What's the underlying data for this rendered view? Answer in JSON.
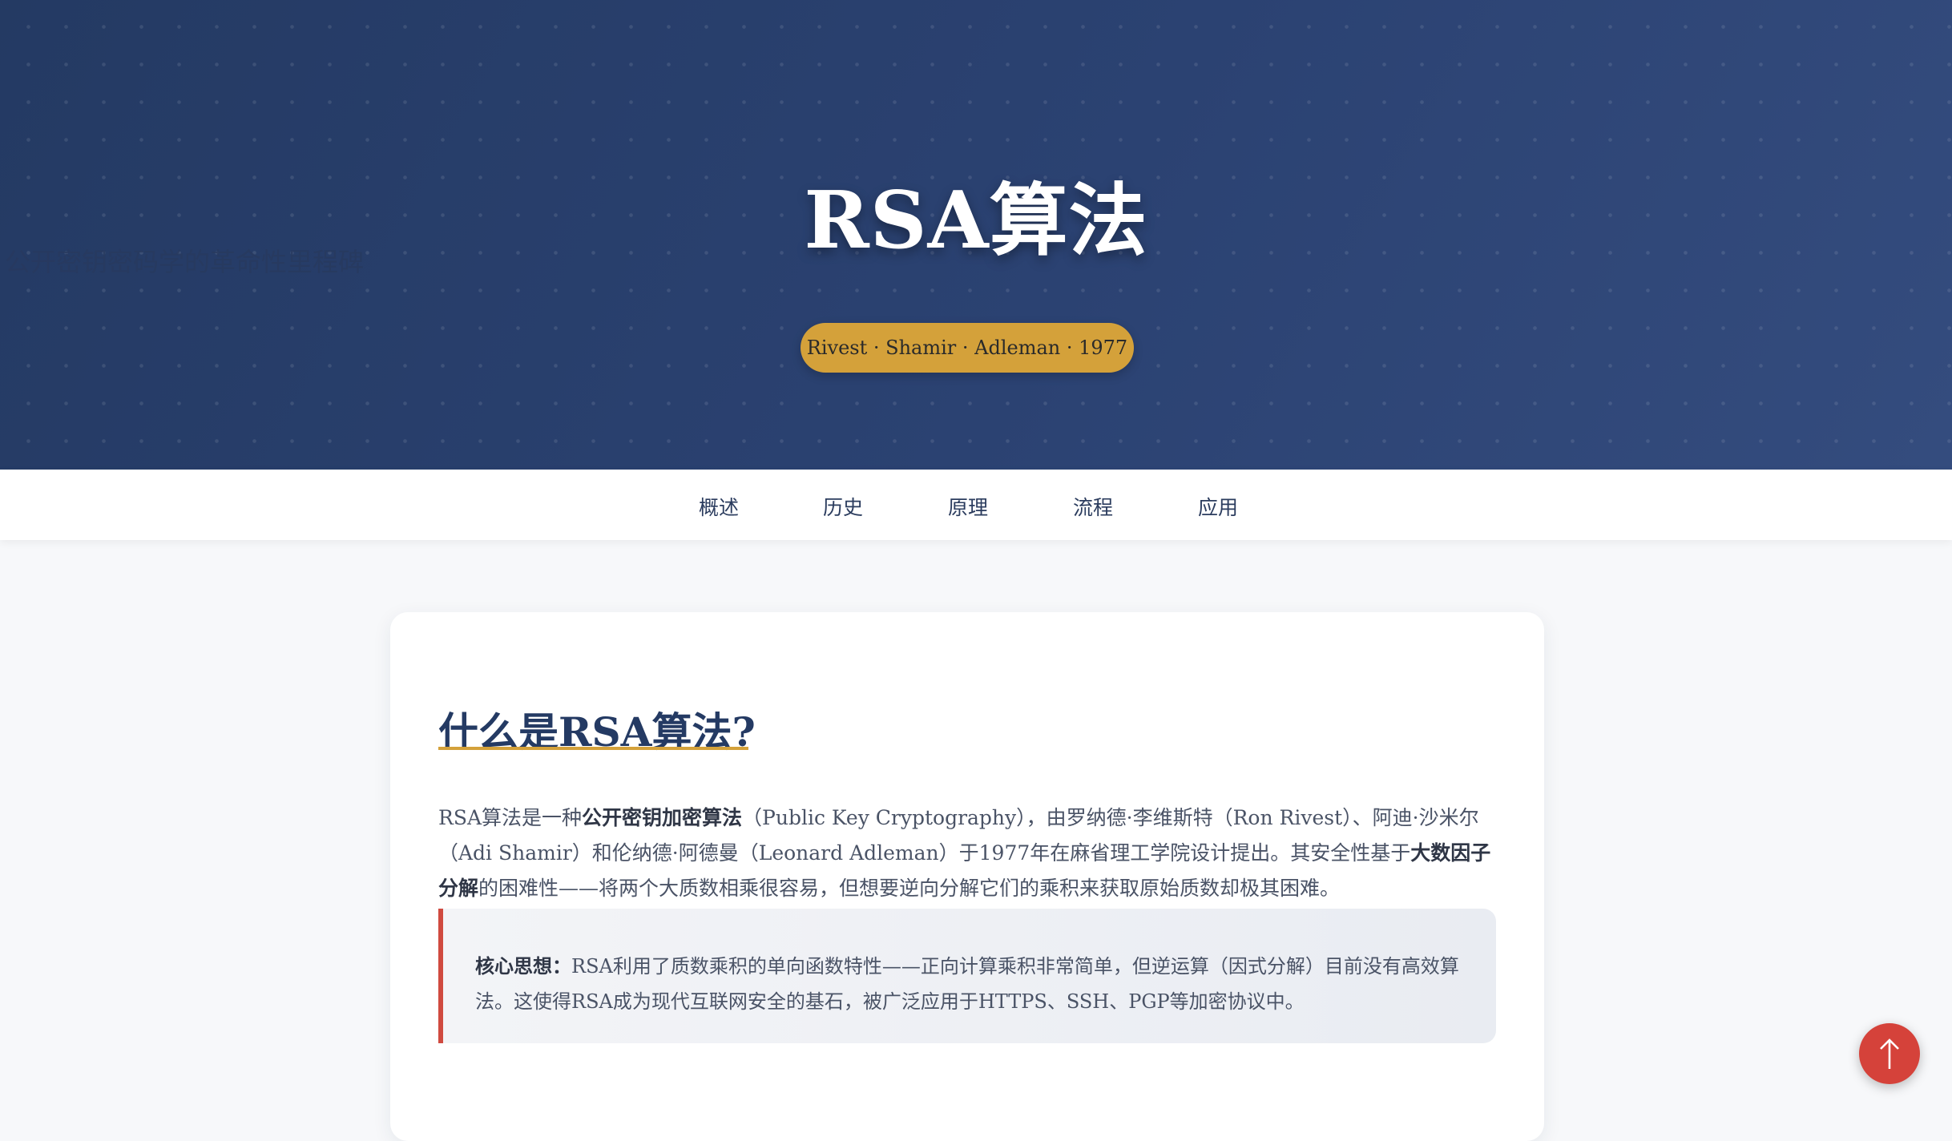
{
  "hero": {
    "title": "RSA算法",
    "subtitle": "公开密钥密码学的革命性里程碑",
    "badge": "Rivest · Shamir · Adleman · 1977"
  },
  "nav": {
    "items": [
      {
        "label": "概述"
      },
      {
        "label": "历史"
      },
      {
        "label": "原理"
      },
      {
        "label": "流程"
      },
      {
        "label": "应用"
      }
    ]
  },
  "overview": {
    "title": "什么是RSA算法?",
    "para": {
      "t1": "RSA算法是一种",
      "b1": "公开密钥加密算法",
      "t2": "（Public Key Cryptography），由罗纳德·李维斯特（Ron Rivest）、阿迪·沙米尔（Adi Shamir）和伦纳德·阿德曼（Leonard Adleman）于1977年在麻省理工学院设计提出。其安全性基于",
      "b2": "大数因子分解",
      "t3": "的困难性——将两个大质数相乘很容易，但想要逆向分解它们的乘积来获取原始质数却极其困难。"
    },
    "callout": {
      "label": "核心思想：",
      "text": "RSA利用了质数乘积的单向函数特性——正向计算乘积非常简单，但逆运算（因式分解）目前没有高效算法。这使得RSA成为现代互联网安全的基石，被广泛应用于HTTPS、SSH、PGP等加密协议中。"
    }
  },
  "back_to_top": {
    "icon": "arrow-up-icon"
  },
  "colors": {
    "hero_bg": "#2b4272",
    "accent_gold": "#d4a13a",
    "accent_red": "#d5423a",
    "title_navy": "#243a63"
  }
}
